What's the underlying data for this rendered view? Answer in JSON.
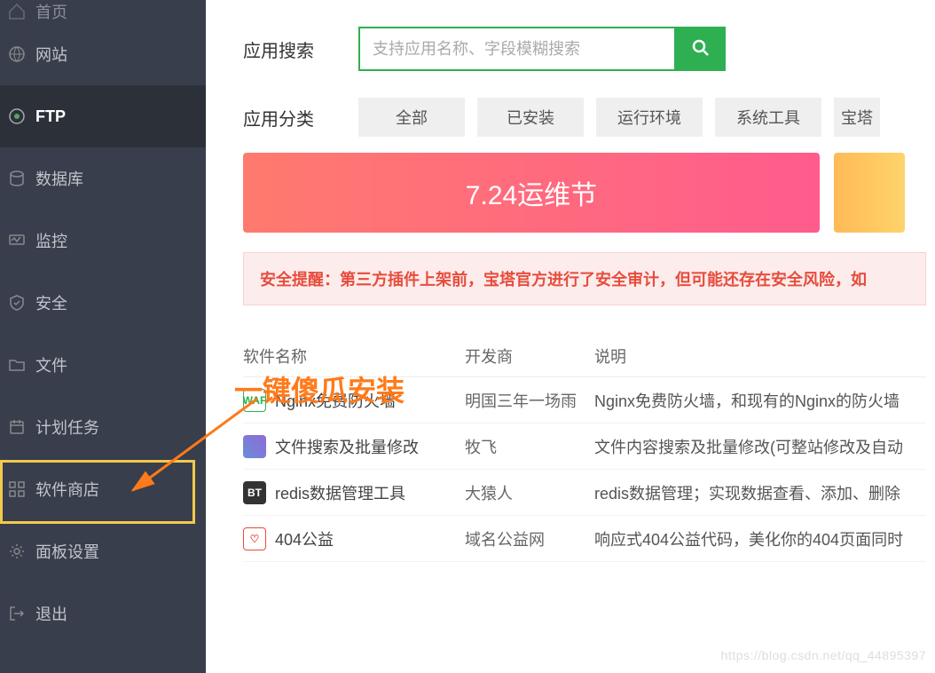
{
  "sidebar": {
    "items": [
      {
        "label": "首页",
        "icon": "home"
      },
      {
        "label": "网站",
        "icon": "globe"
      },
      {
        "label": "FTP",
        "icon": "ftp",
        "active": true
      },
      {
        "label": "数据库",
        "icon": "database"
      },
      {
        "label": "监控",
        "icon": "monitor"
      },
      {
        "label": "安全",
        "icon": "shield"
      },
      {
        "label": "文件",
        "icon": "folder"
      },
      {
        "label": "计划任务",
        "icon": "calendar"
      },
      {
        "label": "软件商店",
        "icon": "app-store",
        "highlight": true
      },
      {
        "label": "面板设置",
        "icon": "gear"
      },
      {
        "label": "退出",
        "icon": "logout"
      }
    ]
  },
  "search": {
    "title": "应用搜索",
    "placeholder": "支持应用名称、字段模糊搜索"
  },
  "categories": {
    "title": "应用分类",
    "items": [
      "全部",
      "已安装",
      "运行环境",
      "系统工具",
      "宝塔"
    ]
  },
  "banner": {
    "text": "7.24运维节"
  },
  "warning": "安全提醒：第三方插件上架前，宝塔官方进行了安全审计，但可能还存在安全风险，如",
  "annotation": "一键傻瓜安装",
  "table": {
    "headers": [
      "软件名称",
      "开发商",
      "说明"
    ],
    "rows": [
      {
        "icon": {
          "text": "WAF",
          "bg": "#fff",
          "color": "#2eaf52",
          "border": "1px solid #2eaf52"
        },
        "name": "Nginx免费防火墙",
        "dev": "明国三年一场雨",
        "desc": "Nginx免费防火墙，和现有的Nginx的防火墙"
      },
      {
        "icon": {
          "text": "",
          "bg": "linear-gradient(45deg,#6b8dd6,#8e6bd6)",
          "color": "#fff"
        },
        "name": "文件搜索及批量修改",
        "dev": "牧飞",
        "desc": "文件内容搜索及批量修改(可整站修改及自动"
      },
      {
        "icon": {
          "text": "BT",
          "bg": "#333",
          "color": "#fff"
        },
        "name": "redis数据管理工具",
        "dev": "大猿人",
        "desc": "redis数据管理；实现数据查看、添加、删除"
      },
      {
        "icon": {
          "text": "♡",
          "bg": "#fff",
          "color": "#e74c3c",
          "border": "1px solid #e74c3c"
        },
        "name": "404公益",
        "dev": "域名公益网",
        "desc": "响应式404公益代码，美化你的404页面同时"
      }
    ]
  },
  "watermark": "https://blog.csdn.net/qq_44895397"
}
